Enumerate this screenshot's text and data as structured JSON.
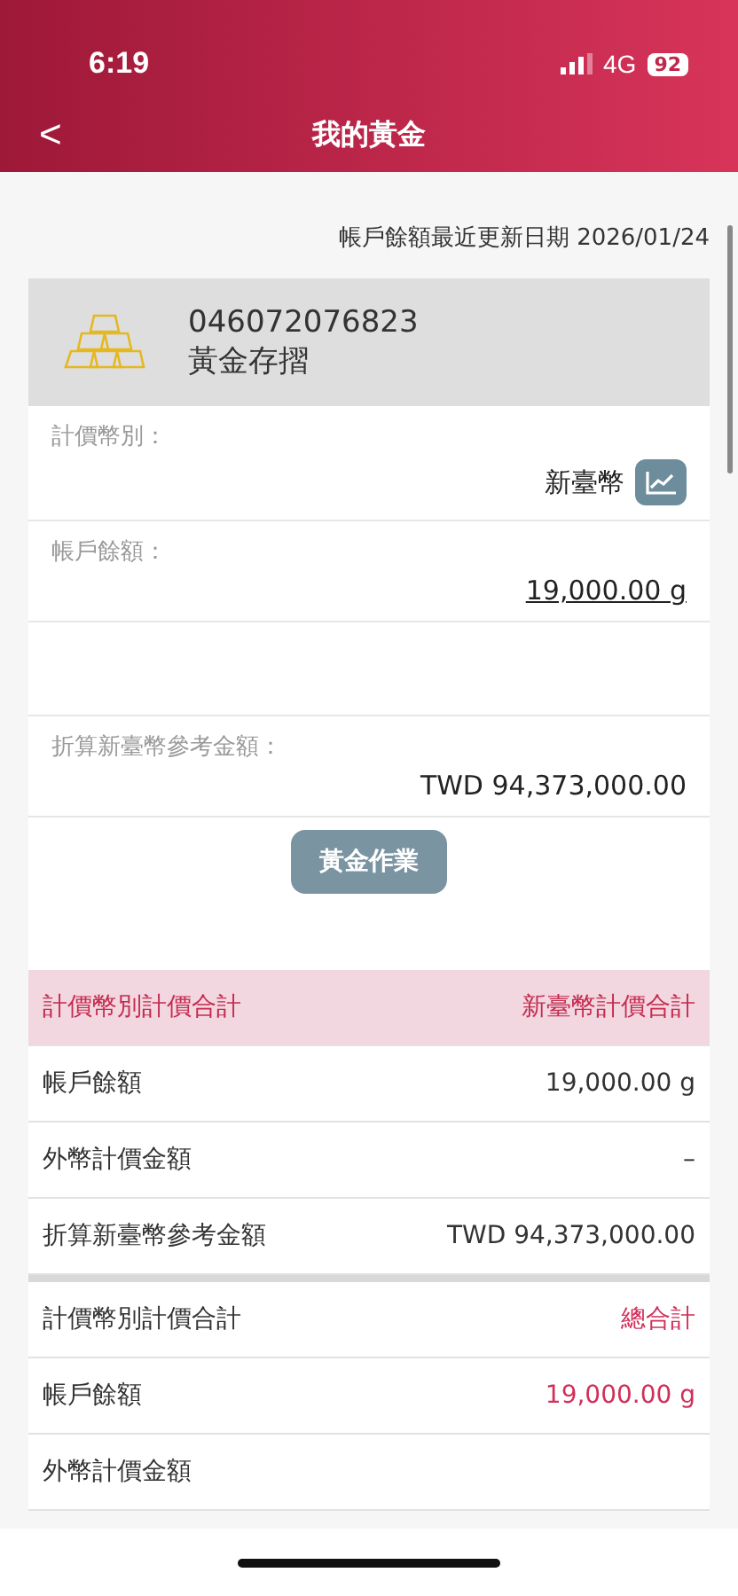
{
  "status_bar": {
    "time": "6:19",
    "network": "4G",
    "battery": "92"
  },
  "nav": {
    "back": "<",
    "title": "我的黃金"
  },
  "update_note": "帳戶餘額最近更新日期 2026/01/24",
  "account": {
    "number": "046072076823",
    "type": "黃金存摺"
  },
  "fields": [
    {
      "kind": "currency",
      "label": "計價幣別：",
      "value": "新臺幣"
    },
    {
      "kind": "link",
      "label": "帳戶餘額：",
      "value": "19,000.00 g"
    },
    {
      "kind": "plain",
      "label": "折算新臺幣參考金額：",
      "value": "TWD 94,373,000.00"
    }
  ],
  "action_button": "黃金作業",
  "tables": [
    {
      "kind": "currency",
      "header": {
        "label": "計價幣別計價合計",
        "value": "新臺幣計價合計"
      },
      "rows": [
        {
          "label": "帳戶餘額",
          "value": "19,000.00 g",
          "emphasis": false
        },
        {
          "label": "外幣計價金額",
          "value": "–",
          "emphasis": false
        },
        {
          "label": "折算新臺幣參考金額",
          "value": "TWD 94,373,000.00",
          "emphasis": false
        }
      ]
    },
    {
      "kind": "total",
      "header": {
        "label": "計價幣別計價合計",
        "value": "總合計"
      },
      "rows": [
        {
          "label": "帳戶餘額",
          "value": "19,000.00 g",
          "emphasis": true
        },
        {
          "label": "外幣計價金額"
        }
      ]
    }
  ]
}
